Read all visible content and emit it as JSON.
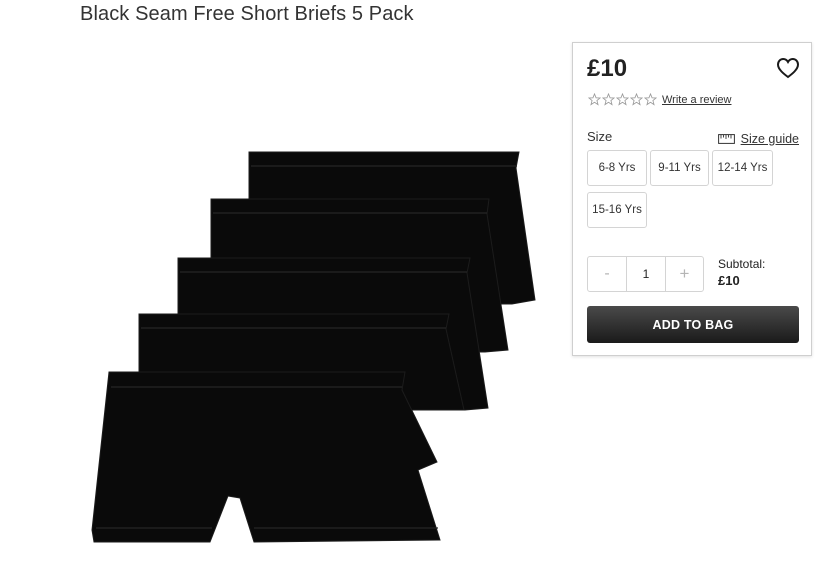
{
  "product": {
    "title": "Black Seam Free Short Briefs 5 Pack",
    "image_icon": "product-photo",
    "price": "£10",
    "wishlist_icon": "heart-outline-icon",
    "rating": {
      "stars_filled": 0,
      "stars_total": 5,
      "write_review_label": "Write a review"
    },
    "size": {
      "label": "Size",
      "guide_label": "Size guide",
      "guide_icon": "ruler-icon",
      "options": [
        "6-8 Yrs",
        "9-11 Yrs",
        "12-14 Yrs",
        "15-16 Yrs"
      ]
    },
    "quantity": {
      "minus_label": "-",
      "value": "1",
      "plus_label": "+"
    },
    "subtotal": {
      "label": "Subtotal:",
      "value": "£10"
    },
    "add_to_bag_label": "ADD TO BAG"
  },
  "colors": {
    "button_dark": "#1a1a1a",
    "border": "#d4d4d4",
    "product": "#0a0a0a"
  }
}
